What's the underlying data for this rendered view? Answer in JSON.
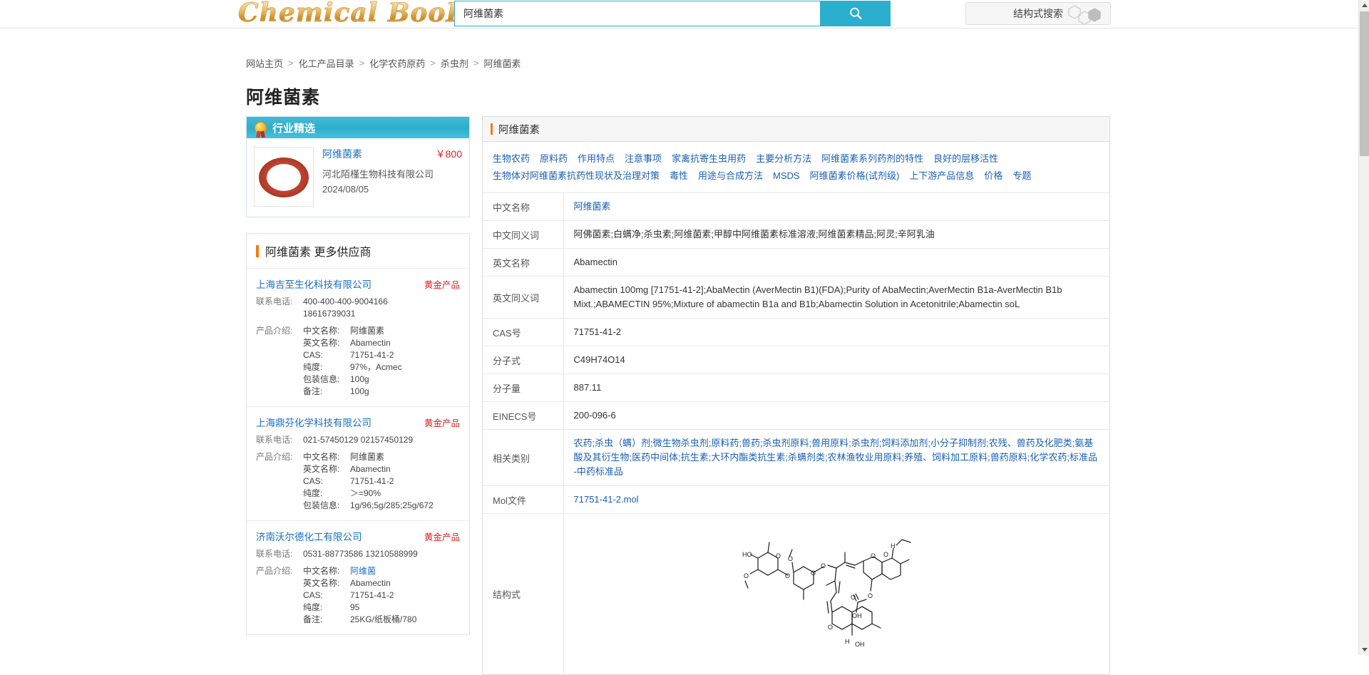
{
  "header": {
    "logo_text": "Chemical BooK",
    "search_value": "阿维菌素",
    "search_placeholder": "",
    "search_icon": "search-icon",
    "structure_search_label": "结构式搜索"
  },
  "breadcrumb": {
    "items": [
      "网站主页",
      "化工产品目录",
      "化学农药原药",
      "杀虫剂",
      "阿维菌素"
    ],
    "separator": ">"
  },
  "page_title": "阿维菌素",
  "featured": {
    "header_label": "行业精选",
    "header_icon": "medal-icon",
    "product_image": "white-powder-in-red-dish",
    "product_name": "阿维菌素",
    "price": "￥800",
    "company": "河北陌槿生物科技有限公司",
    "date": "2024/08/05"
  },
  "suppliers": {
    "section_title": "阿维菌素 更多供应商",
    "labels": {
      "phone": "联系电话:",
      "intro": "产品介绍:",
      "cn_name": "中文名称:",
      "en_name": "英文名称:",
      "cas": "CAS:",
      "purity": "纯度:",
      "package": "包装信息:",
      "remark": "备注:"
    },
    "items": [
      {
        "company": "上海吉至生化科技有限公司",
        "badge": "黄金产品",
        "phone": "400-400-400-9004166",
        "phone2": "18616739031",
        "cn_name": "阿维菌素",
        "cn_name_is_link": false,
        "en_name": "Abamectin",
        "cas": "71751-41-2",
        "purity": "97%，Acmec",
        "package": "100g",
        "remark": "100g"
      },
      {
        "company": "上海鼎芬化学科技有限公司",
        "badge": "黄金产品",
        "phone": "021-57450129 02157450129",
        "phone2": "",
        "cn_name": "阿维菌素",
        "cn_name_is_link": false,
        "en_name": "Abamectin",
        "cas": "71751-41-2",
        "purity": "＞=90%",
        "package": "1g/96;5g/285;25g/672",
        "remark": ""
      },
      {
        "company": "济南沃尔德化工有限公司",
        "badge": "黄金产品",
        "phone": "0531-88773586 13210588999",
        "phone2": "",
        "cn_name": "阿维菌",
        "cn_name_is_link": true,
        "en_name": "Abamectin",
        "cas": "71751-41-2",
        "purity": "95",
        "package": "",
        "remark": "25KG/纸板桶/780"
      }
    ]
  },
  "detail": {
    "panel_title": "阿维菌素",
    "tag_links": [
      "生物农药",
      "原料药",
      "作用特点",
      "注意事项",
      "家禽抗寄生虫用药",
      "主要分析方法",
      "阿维菌素系列药剂的特性",
      "良好的层移活性",
      "生物体对阿维菌素抗药性现状及治理对策",
      "毒性",
      "用途与合成方法",
      "MSDS",
      "阿维菌素价格(试剂级)",
      "上下游产品信息",
      "价格",
      "专题"
    ],
    "rows": [
      {
        "label": "中文名称",
        "value": "阿维菌素",
        "is_link": true
      },
      {
        "label": "中文同义词",
        "value": "阿佛菌素;白螨净;杀虫素;阿维菌素;甲醇中阿维菌素标准溶液;阿维菌素精品;阿灵;辛阿乳油",
        "is_link": false
      },
      {
        "label": "英文名称",
        "value": "Abamectin",
        "is_link": false
      },
      {
        "label": "英文同义词",
        "value": "Abamectin 100mg [71751-41-2];AbaMectin (AverMectin B1)(FDA);Purity of AbaMectin;AverMectin B1a-AverMectin B1b Mixt.;ABAMECTIN 95%;Mixture of abamectin B1a and B1b;Abamectin Solution in Acetonitrile;Abamectin soL",
        "is_link": false
      },
      {
        "label": "CAS号",
        "value": "71751-41-2",
        "is_link": false
      },
      {
        "label": "分子式",
        "value": "C49H74O14",
        "is_link": false
      },
      {
        "label": "分子量",
        "value": "887.11",
        "is_link": false
      },
      {
        "label": "EINECS号",
        "value": "200-096-6",
        "is_link": false
      },
      {
        "label": "相关类别",
        "value": "农药;杀虫（螨）剂;微生物杀虫剂;原料药;兽药;杀虫剂原料;兽用原料;杀虫剂;饲料添加剂;小分子抑制剂;农残、兽药及化肥类;氨基酸及其衍生物;医药中间体;抗生素;大环内酯类抗生素;杀螨剂类;农林渔牧业用原料;养殖、饲料加工原料;兽药原料;化学农药;标准品 -中药标准品",
        "is_link": true
      },
      {
        "label": "Mol文件",
        "value": "71751-41-2.mol",
        "is_link": true
      }
    ],
    "structure_label": "结构式",
    "structure_alt": "abamectin-chemical-structure"
  },
  "scrollbar": {
    "up_icon": "chevron-up-icon",
    "down_icon": "chevron-down-icon"
  },
  "colors": {
    "accent": "#2bafce",
    "link": "#1a5fb4",
    "price": "#e02020",
    "orange_bar": "#f07d18"
  }
}
